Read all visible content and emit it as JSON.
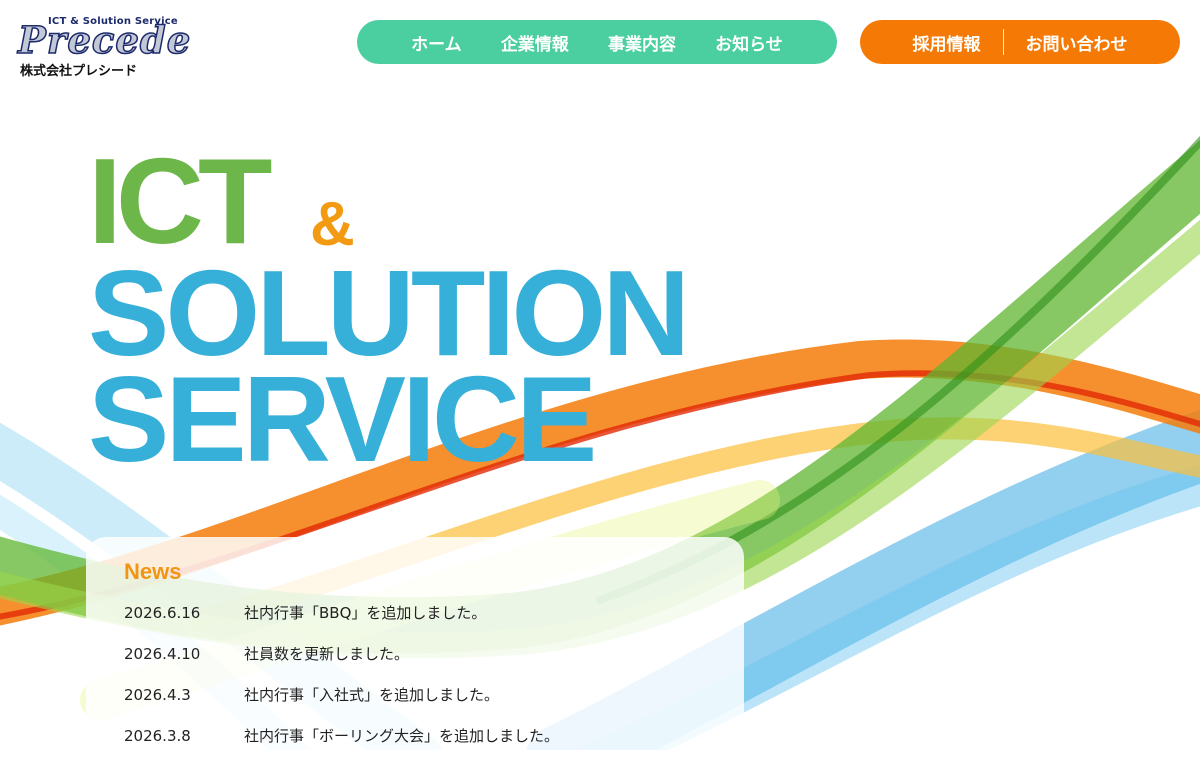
{
  "header": {
    "logo": {
      "tagline": "ICT & Solution Service",
      "wordmark": "Precede",
      "company_name": "株式会社プレシード"
    },
    "main_nav": [
      {
        "label": "ホーム"
      },
      {
        "label": "企業情報"
      },
      {
        "label": "事業内容"
      },
      {
        "label": "お知らせ"
      }
    ],
    "sub_nav": [
      {
        "label": "採用情報"
      },
      {
        "label": "お問い合わせ"
      }
    ]
  },
  "hero": {
    "line1": "ICT",
    "ampersand": "&",
    "line2": "SOLUTION",
    "line3": "SERVICE"
  },
  "news": {
    "heading": "News",
    "items": [
      {
        "date": "2026.6.16",
        "title": "社内行事「BBQ」を追加しました。"
      },
      {
        "date": "2026.4.10",
        "title": "社員数を更新しました。"
      },
      {
        "date": "2026.4.3",
        "title": "社内行事「入社式」を追加しました。"
      },
      {
        "date": "2026.3.8",
        "title": "社内行事「ボーリング大会」を追加しました。"
      }
    ]
  },
  "colors": {
    "main_nav_bg": "#4ccfa0",
    "sub_nav_bg": "#f57a05",
    "hero_green": "#6db649",
    "hero_blue": "#37b0d9",
    "hero_orange": "#f29a12",
    "news_heading": "#f39412"
  }
}
